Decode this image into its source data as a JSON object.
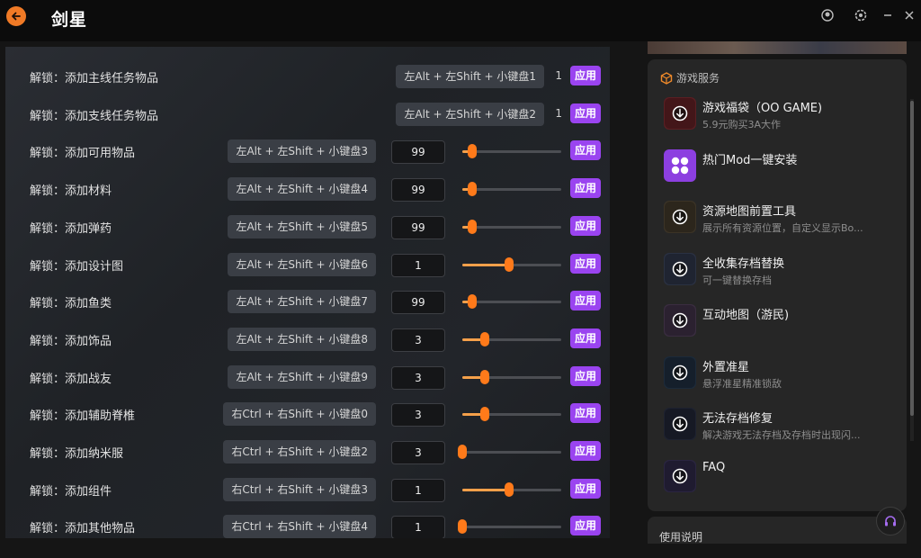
{
  "app": {
    "title": "剑星"
  },
  "rows": [
    {
      "label": "解锁：添加主线任务物品",
      "hotkey": "左Alt + 左Shift + 小键盘1",
      "count": "1",
      "apply": "应用",
      "type": "count"
    },
    {
      "label": "解锁：添加支线任务物品",
      "hotkey": "左Alt + 左Shift + 小键盘2",
      "count": "1",
      "apply": "应用",
      "type": "count"
    },
    {
      "label": "解锁：添加可用物品",
      "hotkey": "左Alt + 左Shift + 小键盘3",
      "value": "99",
      "level": 0.1,
      "apply": "应用",
      "type": "slider"
    },
    {
      "label": "解锁：添加材料",
      "hotkey": "左Alt + 左Shift + 小键盘4",
      "value": "99",
      "level": 0.1,
      "apply": "应用",
      "type": "slider"
    },
    {
      "label": "解锁：添加弹药",
      "hotkey": "左Alt + 左Shift + 小键盘5",
      "value": "99",
      "level": 0.1,
      "apply": "应用",
      "type": "slider"
    },
    {
      "label": "解锁：添加设计图",
      "hotkey": "左Alt + 左Shift + 小键盘6",
      "value": "1",
      "level": 0.47,
      "apply": "应用",
      "type": "slider"
    },
    {
      "label": "解锁：添加鱼类",
      "hotkey": "左Alt + 左Shift + 小键盘7",
      "value": "99",
      "level": 0.1,
      "apply": "应用",
      "type": "slider"
    },
    {
      "label": "解锁：添加饰品",
      "hotkey": "左Alt + 左Shift + 小键盘8",
      "value": "3",
      "level": 0.23,
      "apply": "应用",
      "type": "slider"
    },
    {
      "label": "解锁：添加战友",
      "hotkey": "左Alt + 左Shift + 小键盘9",
      "value": "3",
      "level": 0.23,
      "apply": "应用",
      "type": "slider"
    },
    {
      "label": "解锁：添加辅助脊椎",
      "hotkey": "右Ctrl + 右Shift + 小键盘0",
      "value": "3",
      "level": 0.23,
      "apply": "应用",
      "type": "slider"
    },
    {
      "label": "解锁：添加纳米服",
      "hotkey": "右Ctrl + 右Shift + 小键盘2",
      "value": "3",
      "level": 0.0,
      "apply": "应用",
      "type": "slider"
    },
    {
      "label": "解锁：添加组件",
      "hotkey": "右Ctrl + 右Shift + 小键盘3",
      "value": "1",
      "level": 0.47,
      "apply": "应用",
      "type": "slider"
    },
    {
      "label": "解锁：添加其他物品",
      "hotkey": "右Ctrl + 右Shift + 小键盘4",
      "value": "1",
      "level": 0.0,
      "apply": "应用",
      "type": "slider"
    }
  ],
  "services": {
    "heading": "游戏服务",
    "items": [
      {
        "title": "游戏福袋（OO GAME)",
        "subtitle": "5.9元购买3A大作",
        "icon": "download-icon",
        "color": "#5a1e22"
      },
      {
        "title": "热门Mod一键安装",
        "subtitle": "",
        "icon": "mod-icon",
        "color": "#8c3fe0"
      },
      {
        "title": "资源地图前置工具",
        "subtitle": "展示所有资源位置，自定义显示Bo...",
        "icon": "download-icon",
        "color": "#3b3326"
      },
      {
        "title": "全收集存档替换",
        "subtitle": "可一键替换存档",
        "icon": "download-icon",
        "color": "#2a3142"
      },
      {
        "title": "互动地图（游民)",
        "subtitle": "",
        "icon": "download-icon",
        "color": "#3a2d40"
      },
      {
        "title": "外置准星",
        "subtitle": "悬浮准星精准锁敌",
        "icon": "download-icon",
        "color": "#1c2a3a"
      },
      {
        "title": "无法存档修复",
        "subtitle": "解决游戏无法存档及存档时出现闪...",
        "icon": "download-icon",
        "color": "#1e2230"
      },
      {
        "title": "FAQ",
        "subtitle": "",
        "icon": "download-icon",
        "color": "#2a2540"
      }
    ]
  },
  "usage": {
    "label": "使用说明"
  },
  "colors": {
    "accent": "#9a44f0",
    "slider": "#ff7a1a",
    "back": "#f07a26"
  }
}
